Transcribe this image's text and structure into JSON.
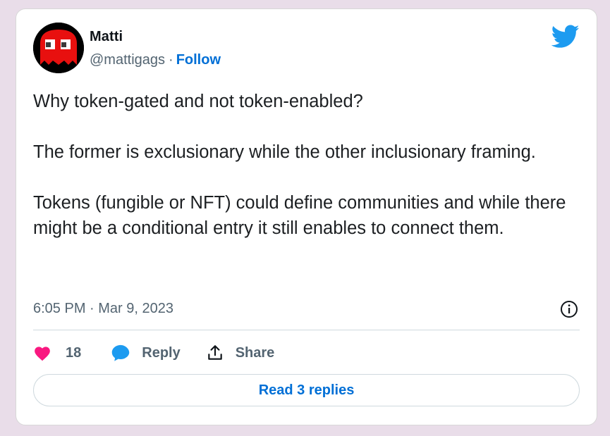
{
  "author": {
    "name": "Matti",
    "handle": "@mattigags",
    "separator": "·",
    "follow_label": "Follow",
    "avatar_icon": "red-ghost-avatar"
  },
  "brand": {
    "icon": "twitter-bird-icon",
    "color": "#1d9bf0"
  },
  "tweet": {
    "paragraphs": [
      "Why token-gated and not token-enabled?",
      "The former is exclusionary while the other inclusionary framing.",
      "Tokens (fungible or NFT) could define communities and while there might be a conditional entry it still enables to connect them."
    ],
    "timestamp": "6:05 PM · Mar 9, 2023"
  },
  "actions": {
    "like_count": "18",
    "reply_label": "Reply",
    "share_label": "Share",
    "read_replies_label": "Read 3 replies"
  },
  "colors": {
    "like": "#f91880",
    "link": "#006fd6",
    "reply_icon": "#1d9bf0",
    "background": "#e9dde9"
  }
}
